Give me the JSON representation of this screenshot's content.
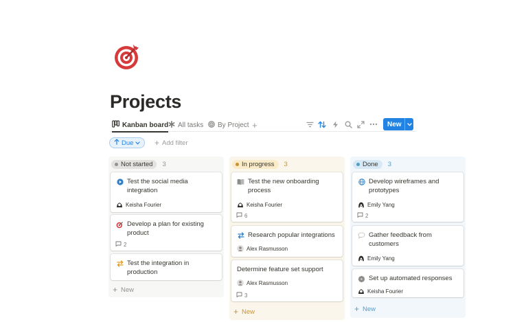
{
  "page": {
    "title": "Projects",
    "icon": "target-icon"
  },
  "views": [
    {
      "label": "Kanban board",
      "icon": "board-icon",
      "active": true
    },
    {
      "label": "All tasks",
      "icon": "asterisk-icon",
      "active": false
    },
    {
      "label": "By Project",
      "icon": "target-small-icon",
      "active": false
    }
  ],
  "toolbar": {
    "icons": [
      "filter-icon",
      "sort-icon",
      "automation-icon",
      "search-icon",
      "expand-icon",
      "more-icon"
    ],
    "new_label": "New"
  },
  "filters": {
    "sort_chip": "Due",
    "add_filter": "Add filter"
  },
  "colors": {
    "accent": "#2383e2",
    "not_started": "#91918e",
    "in_progress": "#cb912f",
    "done": "#529cca"
  },
  "columns": [
    {
      "status": "Not started",
      "count": "3",
      "new_label": "New",
      "cards": [
        {
          "title": "Test the social media integration",
          "icon": "play-icon",
          "assignee": "Keisha Fourier"
        },
        {
          "title": "Develop a plan for existing product",
          "icon": "dart-icon",
          "comments": "2"
        },
        {
          "title": "Test the integration in production",
          "icon": "swap-arrows-icon"
        }
      ]
    },
    {
      "status": "In progress",
      "count": "3",
      "new_label": "New",
      "cards": [
        {
          "title": "Test the new onboarding process",
          "icon": "book-icon",
          "assignee": "Keisha Fourier",
          "comments": "6"
        },
        {
          "title": "Research popular integrations",
          "icon": "swap-arrows-icon",
          "assignee": "Alex Rasmusson"
        },
        {
          "title": "Determine feature set support",
          "assignee": "Alex Rasmusson",
          "comments": "3"
        }
      ]
    },
    {
      "status": "Done",
      "count": "3",
      "new_label": "New",
      "cards": [
        {
          "title": "Develop wireframes and prototypes",
          "icon": "globe-icon",
          "assignee": "Emily Yang",
          "comments": "2"
        },
        {
          "title": "Gather feedback from customers",
          "icon": "speech-bubble-icon",
          "assignee": "Emily Yang"
        },
        {
          "title": "Set up automated responses",
          "icon": "gear-icon",
          "assignee": "Keisha Fourier"
        }
      ]
    }
  ]
}
